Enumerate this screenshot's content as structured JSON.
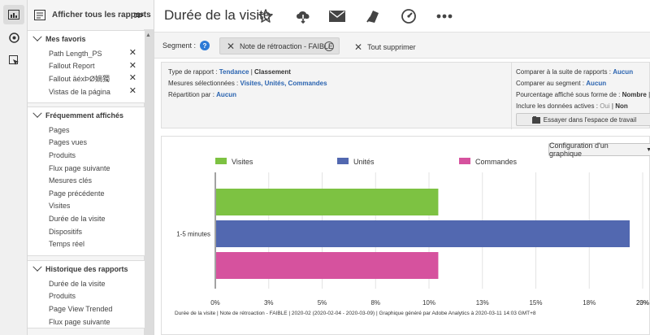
{
  "sidebar": {
    "header_label": "Afficher tous les rapports",
    "favorites": {
      "title": "Mes favoris",
      "items": [
        "Path Length_PS",
        "Fallout Report",
        "Fallout äéxÞØ嫡獨",
        "Vistas de la página"
      ]
    },
    "frequent": {
      "title": "Fréquemment affichés",
      "items": [
        "Pages",
        "Pages vues",
        "Produits",
        "Flux page suivante",
        "Mesures clés",
        "Page précédente",
        "Visites",
        "Durée de la visite",
        "Dispositifs",
        "Temps réel"
      ]
    },
    "history": {
      "title": "Historique des rapports",
      "items": [
        "Durée de la visite",
        "Produits",
        "Page View Trended",
        "Flux page suivante"
      ]
    }
  },
  "topbar": {
    "title": "Durée de la visite",
    "icons": [
      "star-icon",
      "cloud-download-icon",
      "mail-icon",
      "bookmark-icon",
      "gauge-icon",
      "more-icon"
    ]
  },
  "segment": {
    "label": "Segment :",
    "help": "?",
    "chip": "Note de rétroaction - FAIBLE",
    "clear_all": "Tout supprimer"
  },
  "info": {
    "report_type_label": "Type de rapport :",
    "report_type_link": "Tendance",
    "report_type_sep": "|",
    "report_type_current": "Classement",
    "metrics_label": "Mesures sélectionnées :",
    "metrics": [
      "Visites",
      "Unités",
      "Commandes"
    ],
    "breakdown_label": "Répartition par :",
    "breakdown_value": "Aucun",
    "compare_suite_label": "Comparer à la suite de rapports :",
    "compare_suite_value": "Aucun",
    "compare_segment_label": "Comparer au segment :",
    "compare_segment_value": "Aucun",
    "percent_label": "Pourcentage affiché sous forme de :",
    "percent_value": "Nombre",
    "percent_more": "| G",
    "active_label": "Inclure les données actives :",
    "active_oui": "Oui",
    "active_sep": "|",
    "active_non": "Non",
    "try_button": "Essayer dans l'espace de travail"
  },
  "chart": {
    "config_button": "Configuration d'un graphique",
    "footer": "Durée de la visite  | Note de rétroaction - FAIBLE | 2020-02 (2020-02-04 - 2020-03-09) | Graphique généré par Adobe Analytics à 2020-03-11 14:03 GMT+8"
  },
  "chart_data": {
    "type": "bar",
    "orientation": "horizontal",
    "categories": [
      "1-5 minutes"
    ],
    "series": [
      {
        "name": "Visites",
        "values": [
          12.0
        ],
        "color": "#7dc242"
      },
      {
        "name": "Unités",
        "values": [
          22.3
        ],
        "color": "#5268b0"
      },
      {
        "name": "Commandes",
        "values": [
          12.0
        ],
        "color": "#d6529e"
      }
    ],
    "xlim": [
      0,
      23
    ],
    "xticks": [
      0,
      2.875,
      5.75,
      8.625,
      11.5,
      14.375,
      17.25,
      20.125,
      23
    ],
    "xtick_labels": [
      "0%",
      "3%",
      "5%",
      "8%",
      "10%",
      "13%",
      "15%",
      "18%",
      "20%",
      "23%"
    ],
    "legend_position": "top",
    "grid": true
  }
}
